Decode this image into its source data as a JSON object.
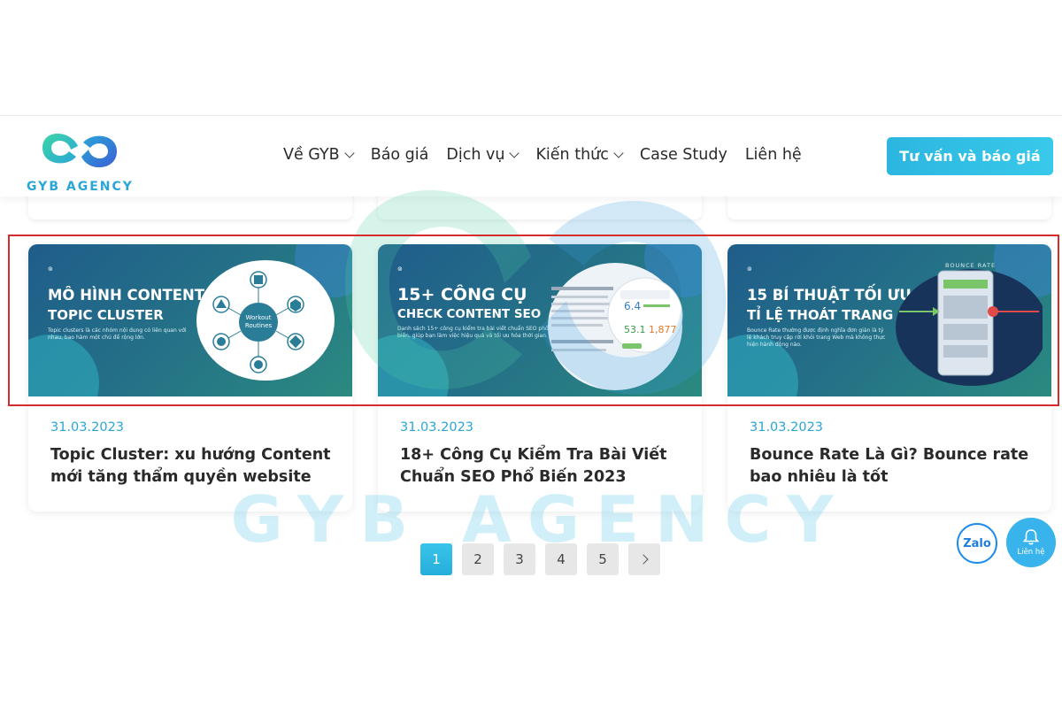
{
  "brand": {
    "name": "GYB AGENCY"
  },
  "nav": {
    "items": [
      {
        "label": "Về GYB",
        "has_dropdown": true
      },
      {
        "label": "Báo giá",
        "has_dropdown": false
      },
      {
        "label": "Dịch vụ",
        "has_dropdown": true
      },
      {
        "label": "Kiến thức",
        "has_dropdown": true
      },
      {
        "label": "Case Study",
        "has_dropdown": false
      },
      {
        "label": "Liên hệ",
        "has_dropdown": false
      }
    ],
    "cta_label": "Tư vấn và báo giá"
  },
  "posts": [
    {
      "thumb_title_1": "MÔ HÌNH CONTENT",
      "thumb_title_2": "TOPIC CLUSTER",
      "thumb_desc": "Topic clusters là các nhóm nội dung có liên quan với nhau, bao hàm một chủ đề rộng lớn.",
      "diagram_center": "Workout Routines",
      "date": "31.03.2023",
      "title": "Topic Cluster: xu hướng Content mới tăng thẩm quyền website"
    },
    {
      "thumb_title_1": "15+ CÔNG CỤ",
      "thumb_title_2": "CHECK CONTENT SEO",
      "thumb_desc": "Danh sách 15+ công cụ kiểm tra bài viết chuẩn SEO phổ biến, giúp bạn làm việc hiệu quả và tối ưu hóa thời gian.",
      "date": "31.03.2023",
      "title": "18+ Công Cụ Kiểm Tra Bài Viết Chuẩn SEO Phổ Biến 2023"
    },
    {
      "thumb_title_1": "15 BÍ THUẬT TỐI ƯU",
      "thumb_title_2": "TỈ LỆ THOÁT TRANG",
      "thumb_desc": "Bounce Rate thường được định nghĩa đơn giản là tỷ lệ khách truy cập rời khỏi trang Web mà không thực hiện hành động nào.",
      "mock_label": "BOUNCE RATE",
      "date": "31.03.2023",
      "title": "Bounce Rate Là Gì? Bounce rate bao nhiêu là tốt"
    }
  ],
  "pagination": {
    "pages": [
      "1",
      "2",
      "3",
      "4",
      "5"
    ],
    "current": "1"
  },
  "floating": {
    "zalo_label": "Zalo",
    "contact_label": "Liên hệ"
  },
  "colors": {
    "accent": "#2aa6d6",
    "highlight": "#d62c2c",
    "thumb_bg": "#246f88"
  }
}
